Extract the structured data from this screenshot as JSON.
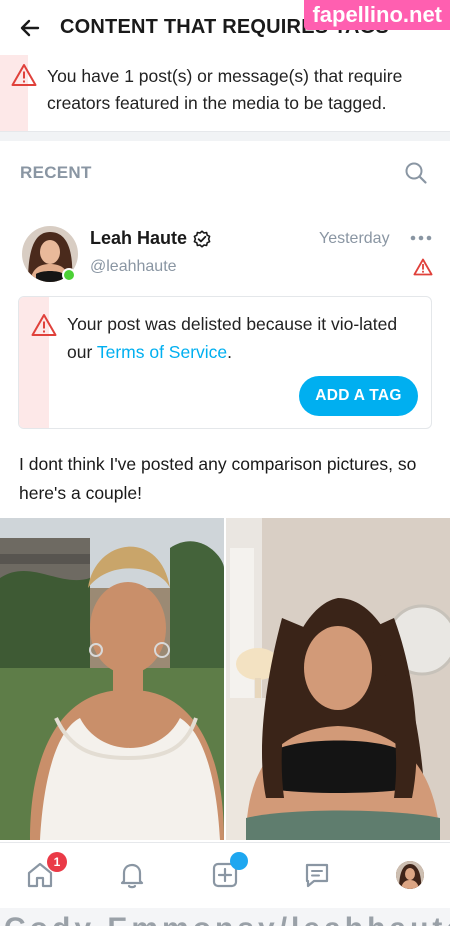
{
  "header": {
    "title": "CONTENT THAT REQUIRES TAGS",
    "watermark": "fapellino.net"
  },
  "notice": {
    "text": "You have 1 post(s) or message(s) that require creators featured in the media to be tagged."
  },
  "recent": {
    "label": "RECENT"
  },
  "post": {
    "author_name": "Leah Haute",
    "author_handle": "@leahhaute",
    "time": "Yesterday",
    "delisted_text_before": "Your post was delisted because it vio-lated our ",
    "delisted_link": "Terms of Service",
    "delisted_text_after": ".",
    "add_tag_label": "ADD A TAG",
    "body": "I dont think I've posted any comparison pictures, so here's a couple!"
  },
  "bottom_nav": {
    "home_badge": "1"
  },
  "under_text": "Cody Emmonsy/leahhaute",
  "colors": {
    "accent": "#00aff0",
    "warning": "#e0413b",
    "warning_bg": "#fde8e8",
    "muted": "#8a96a3",
    "online": "#4cd136",
    "badge": "#ea3a47"
  },
  "icons": {
    "back": "arrow-left-icon",
    "search": "search-icon",
    "verified": "verified-badge-icon",
    "more": "more-dots-icon",
    "warning": "warning-triangle-icon",
    "home": "home-icon",
    "notifications": "bell-icon",
    "create": "plus-square-icon",
    "messages": "chat-icon"
  }
}
